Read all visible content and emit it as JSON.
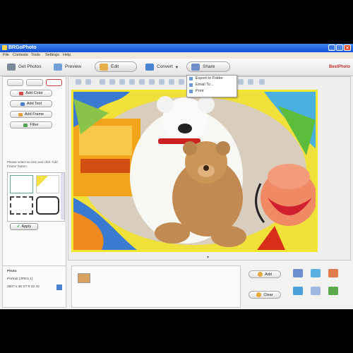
{
  "window": {
    "title": "BRGoPhoto"
  },
  "menu": [
    "File",
    "Contests",
    "Tools",
    "Settings",
    "Help"
  ],
  "toolbar": {
    "buttons": [
      {
        "label": "Get Photos"
      },
      {
        "label": "Preview"
      },
      {
        "label": "Edit"
      },
      {
        "label": "Convert"
      },
      {
        "label": "Share"
      }
    ],
    "brand": "BestPhoto"
  },
  "share_menu": [
    "Export to Folder",
    "Email To...",
    "Print"
  ],
  "left_panel": {
    "buttons": [
      "Add Color",
      "Add Text",
      "Add Frame",
      "Filter"
    ],
    "hint": "Please select an item and click 'Add Frame' button.",
    "apply": "Apply"
  },
  "info": {
    "name_label": "Photo",
    "size": "Portrait (JPEG 1)",
    "dims": "2807 x 30 ST 9 32 42"
  },
  "bottom_buttons": [
    "Add",
    "Clear"
  ],
  "colors": {
    "titlebar": "#1e5fe0",
    "frame_yellow": "#f2e630",
    "accent_red": "#c03030"
  }
}
